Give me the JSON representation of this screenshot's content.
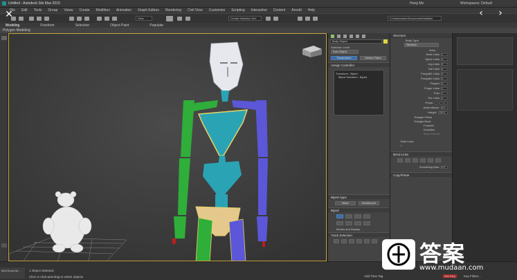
{
  "titlebar": {
    "title": "Untitled - Autodesk 3ds Max 2019",
    "user": "Hong Mo",
    "workspace": "Workspaces: Default"
  },
  "menubar": {
    "items": [
      "File",
      "Edit",
      "Tools",
      "Group",
      "Views",
      "Create",
      "Modifiers",
      "Animation",
      "Graph Editors",
      "Rendering",
      "Civil View",
      "Customize",
      "Scripting",
      "Interactive",
      "Content",
      "Arnold",
      "Help"
    ]
  },
  "toolbar": {
    "selection_set": "Create Selection Set",
    "view_dropdown": "View",
    "path": "C:\\Users\\ambr\\Documents\\3dsMax"
  },
  "ribbon": {
    "tabs": [
      "Modeling",
      "Freeform",
      "Selection",
      "Object Paint",
      "Populate"
    ],
    "sub_label": "Polygon Modeling"
  },
  "viewport": {
    "label": "[+] [Perspective] [Standard] [Default Shading]"
  },
  "command_panel": {
    "object_name": "Body Object",
    "selection_level": "Selection Level:",
    "level_dropdown": "Sub-Object",
    "tab_parameters": "Parameters",
    "tab_motion_paths": "Motion Paths",
    "assign_controller": "Assign Controller",
    "tree_items": [
      "Transform : Biped",
      "Biped SubAnim : Biped"
    ],
    "biped_apps": "Biped Apps",
    "btn_mixer": "Mixer",
    "btn_workbench": "Workbench",
    "biped_section": "Biped",
    "modes_and_display": "Modes and Display",
    "track_selection": "Track Selection"
  },
  "structure_panel": {
    "header": "Structure",
    "body_type_label": "Body Type",
    "body_type": "Skeleton",
    "arms": "Arms",
    "fields": [
      {
        "label": "Neck Links",
        "value": "1"
      },
      {
        "label": "Spine Links",
        "value": "4"
      },
      {
        "label": "Leg Links",
        "value": "3"
      },
      {
        "label": "Tail Links",
        "value": "0"
      },
      {
        "label": "Ponytail1 Links",
        "value": "0"
      },
      {
        "label": "Ponytail2 Links",
        "value": "0"
      },
      {
        "label": "Fingers",
        "value": "0"
      },
      {
        "label": "Finger Links",
        "value": "1"
      },
      {
        "label": "Toes",
        "value": "1"
      },
      {
        "label": "Toe Links",
        "value": "1"
      }
    ],
    "props_label": "Props:",
    "ankle_attach": "Ankle Attach:",
    "ankle_value": "0.2",
    "height_label": "Height:",
    "height_value": "129.0",
    "triangle_pelvis": "Triangle Pelvis",
    "triangle_neck": "Triangle Neck",
    "forefeet": "Forefeet",
    "knuckles": "Knuckles",
    "short_thumb": "Short Thumb",
    "twist_links": "Twist Links",
    "bend_links": "Bend Links",
    "smoothing_bias": "Smoothing Bias:",
    "smoothing_value": "0.5",
    "copy_paste": "Copy/Paste"
  },
  "statusbar": {
    "selected": "1 Object Selected",
    "hint": "Click or click-and-drag to select objects",
    "timeline": "0 / 100",
    "maxscript": "MAXScript Mi...",
    "add_time_tag": "Add Time Tag",
    "set_key": "Set Key",
    "key_filters": "Key Filters..."
  },
  "watermark": {
    "text": "答案",
    "url": "www.mudaan.com"
  },
  "colors": {
    "arm_left": "#2fae3a",
    "arm_right": "#5b57d8",
    "torso": "#2aa4b4",
    "head": "#e6e8ee",
    "pelvis": "#e5c98c",
    "accent": "#3f6da3"
  }
}
